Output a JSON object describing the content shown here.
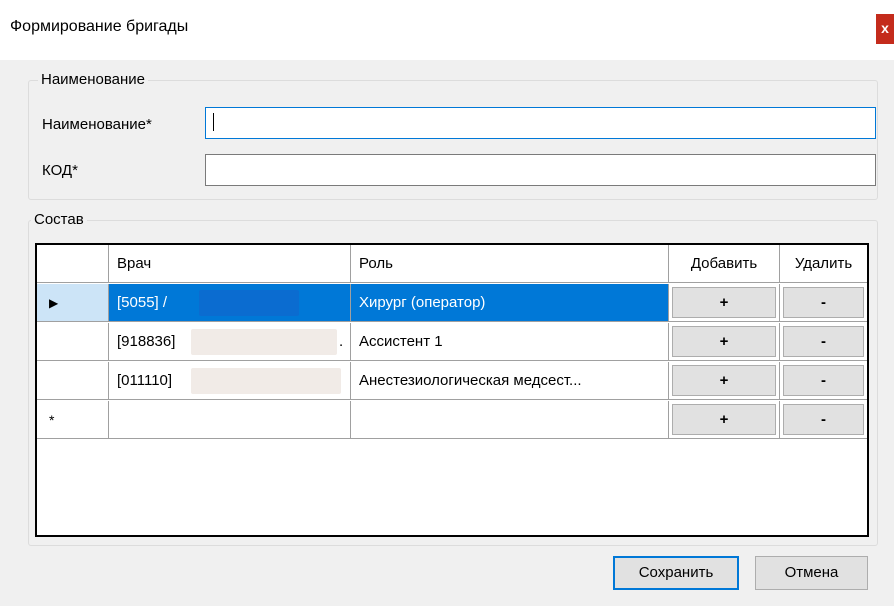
{
  "window": {
    "title": "Формирование бригады",
    "close_label": "x"
  },
  "name_group": {
    "legend": "Наименование",
    "name_label": "Наименование*",
    "name_value": "",
    "code_label": "КОД*",
    "code_value": ""
  },
  "composition_group": {
    "legend": "Состав",
    "columns": {
      "doctor": "Врач",
      "role": "Роль",
      "add": "Добавить",
      "delete": "Удалить"
    },
    "rows": [
      {
        "marker": "▶",
        "doctor": "[5055] /",
        "role": "Хирург (оператор)",
        "add": "+",
        "delete": "-"
      },
      {
        "marker": "",
        "doctor": "[918836]",
        "doctor_suffix": ".",
        "role": "Ассистент 1",
        "add": "+",
        "delete": "-"
      },
      {
        "marker": "",
        "doctor": "[011110]",
        "role": "Анестезиологическая медсест...",
        "add": "+",
        "delete": "-"
      },
      {
        "marker": "*",
        "doctor": "",
        "role": "",
        "add": "+",
        "delete": "-"
      }
    ]
  },
  "buttons": {
    "save": "Сохранить",
    "cancel": "Отмена"
  },
  "colors": {
    "selection": "#0078d7",
    "close": "#c42b1c",
    "background": "#f0f0f0"
  }
}
